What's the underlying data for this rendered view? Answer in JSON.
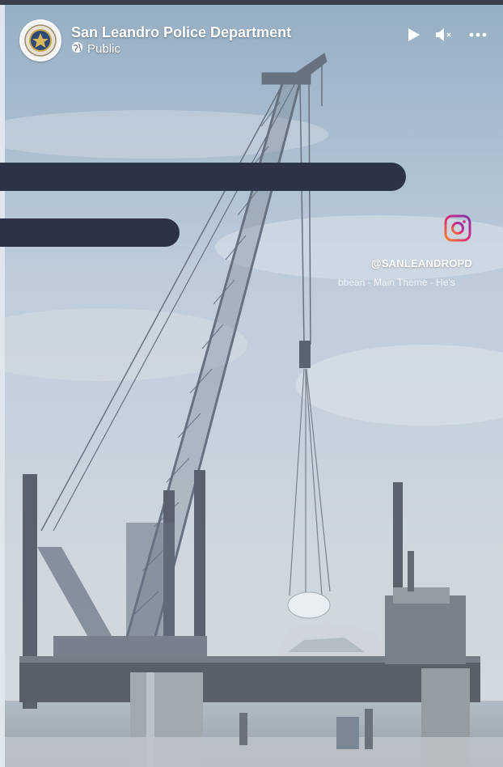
{
  "post": {
    "page_name": "San Leandro Police Department",
    "visibility": "Public"
  },
  "icons": {
    "globe": "globe-icon",
    "play": "play-icon",
    "mute": "volume-mute-icon",
    "more": "more-options-icon",
    "instagram": "instagram-icon"
  },
  "overlay": {
    "instagram_handle": "@SANLEANDROPD",
    "music_caption": "bbean - Main Theme - He's"
  },
  "colors": {
    "redaction": "#2c3347",
    "instagram_gradient_start": "#f58529",
    "instagram_gradient_end": "#dd2a7b"
  }
}
